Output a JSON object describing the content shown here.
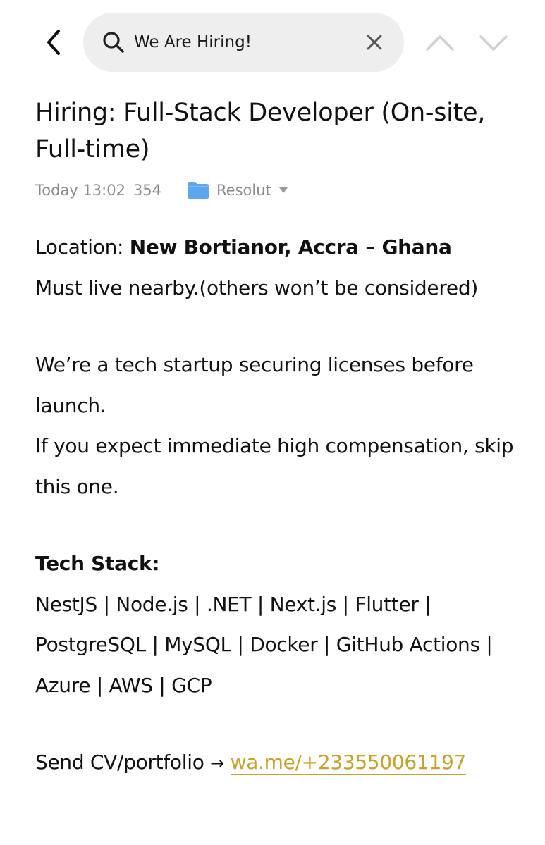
{
  "search": {
    "query": "We Are Hiring!"
  },
  "post": {
    "title": "Hiring: Full-Stack Developer (On-site, Full-time)",
    "time": "Today 13:02",
    "views": "354",
    "category": "Resolut"
  },
  "body": {
    "location_label": "Location: ",
    "location_value": "New Bortianor, Accra – Ghana",
    "residency_note": "Must live nearby.(others won’t be considered)",
    "startup_line": "We’re a tech startup securing  licenses before launch.",
    "expectation_line": "If you expect immediate high compensation, skip this one.",
    "tech_heading": "Tech Stack:",
    "tech_list": "NestJS | Node.js | .NET | Next.js | Flutter | PostgreSQL | MySQL | Docker | GitHub Actions | Azure | AWS | GCP",
    "cta_text": "Send CV/portfolio",
    "cta_arrow": "→",
    "cta_link": "wa.me/+233550061197"
  },
  "colors": {
    "link": "#c9a227",
    "folder": "#5aa6f0",
    "meta_text": "#8a8a8a",
    "search_bg": "#eeeeee"
  },
  "icons": [
    "back-arrow-icon",
    "search-icon",
    "close-icon",
    "chevron-up-icon",
    "chevron-down-icon",
    "folder-icon",
    "caret-down-icon"
  ]
}
